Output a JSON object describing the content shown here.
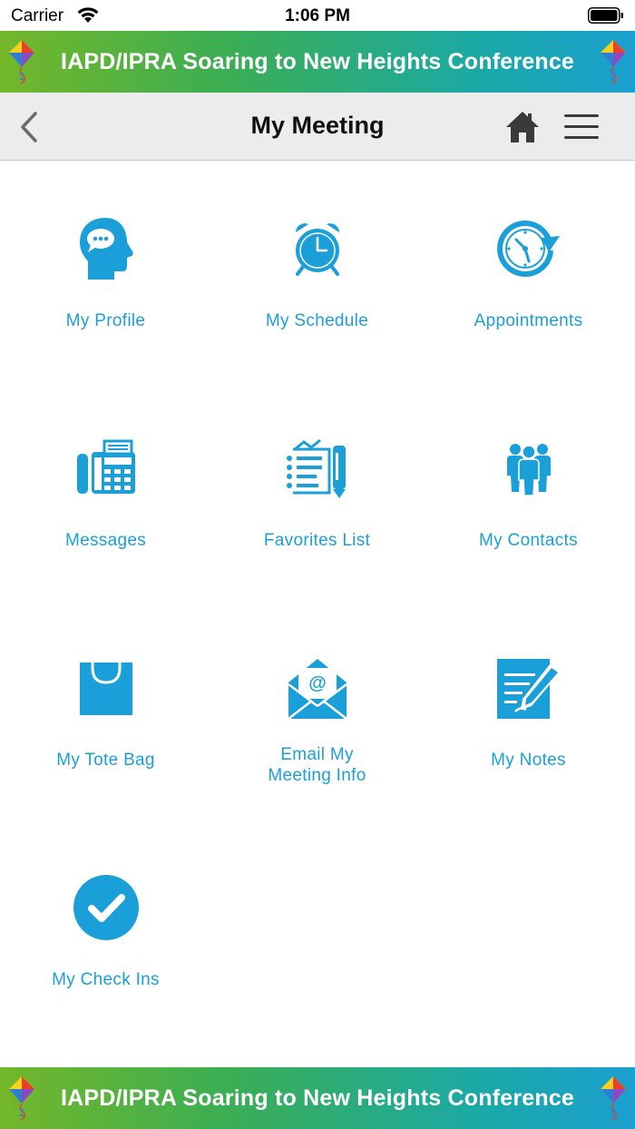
{
  "status_bar": {
    "carrier": "Carrier",
    "time": "1:06 PM"
  },
  "banner": {
    "title": "IAPD/IPRA Soaring to New Heights Conference"
  },
  "nav": {
    "title": "My Meeting"
  },
  "colors": {
    "accent": "#1b9fd8",
    "banner_start": "#74b72a",
    "banner_end": "#1b9fd0",
    "nav_bg": "#ececec"
  },
  "tiles": [
    {
      "label": "My Profile",
      "icon": "profile-head-icon"
    },
    {
      "label": "My Schedule",
      "icon": "alarm-clock-icon"
    },
    {
      "label": "Appointments",
      "icon": "clock-arrow-icon"
    },
    {
      "label": "Messages",
      "icon": "fax-phone-icon"
    },
    {
      "label": "Favorites List",
      "icon": "checklist-pen-icon"
    },
    {
      "label": "My Contacts",
      "icon": "people-group-icon"
    },
    {
      "label": "My Tote Bag",
      "icon": "shopping-bag-icon"
    },
    {
      "label": "Email My Meeting Info",
      "label_line1": "Email My",
      "label_line2": "Meeting Info",
      "icon": "email-envelope-icon"
    },
    {
      "label": "My Notes",
      "icon": "notes-pencil-icon"
    },
    {
      "label": "My Check Ins",
      "icon": "checkmark-circle-icon"
    }
  ]
}
